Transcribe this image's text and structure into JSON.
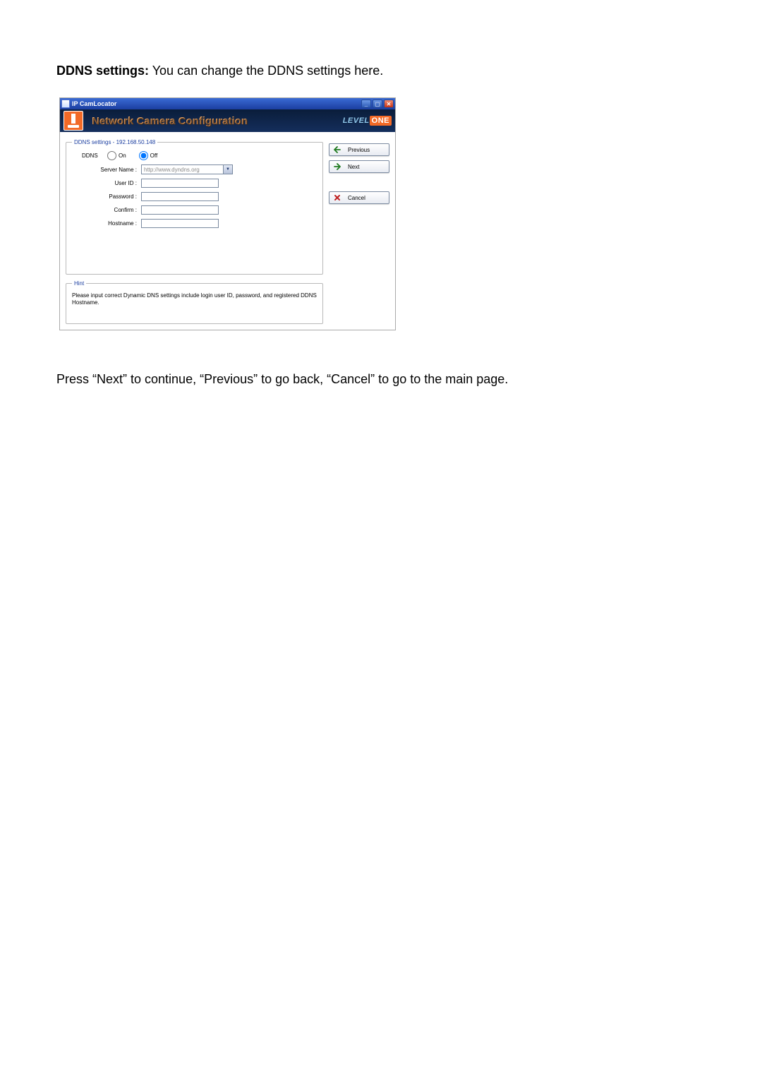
{
  "doc": {
    "intro_bold": "DDNS settings:",
    "intro_rest": " You can change the DDNS settings here.",
    "outro": "Press “Next” to continue, “Previous” to go back, “Cancel” to go to the main page."
  },
  "window": {
    "title": "IP CamLocator",
    "banner_title": "Network Camera Configuration",
    "brand_prefix": "LEVEL",
    "brand_suffix": "ONE"
  },
  "settings": {
    "legend": "DDNS settings - 192.168.50.148",
    "ddns_label": "DDNS",
    "radio_on": "On",
    "radio_off": "Off",
    "selected_radio": "off",
    "server_name_label": "Server Name :",
    "server_name_value": "http://www.dyndns.org",
    "user_id_label": "User ID :",
    "user_id_value": "",
    "password_label": "Password :",
    "password_value": "",
    "confirm_label": "Confirm :",
    "confirm_value": "",
    "hostname_label": "Hostname :",
    "hostname_value": ""
  },
  "hint": {
    "legend": "Hint",
    "text": "Please input correct Dynamic DNS settings include login user ID, password, and registered DDNS Hostname."
  },
  "nav": {
    "previous": "Previous",
    "next": "Next",
    "cancel": "Cancel"
  }
}
